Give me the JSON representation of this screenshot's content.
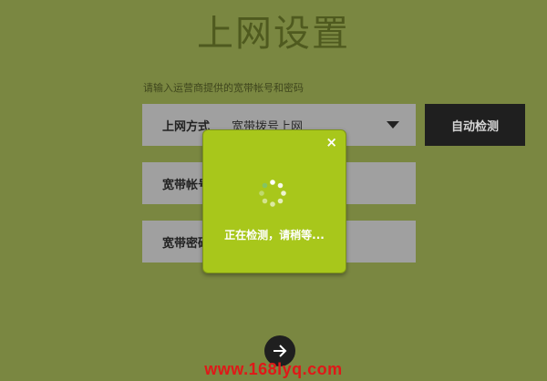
{
  "page": {
    "title": "上网设置",
    "hint": "请输入运营商提供的宽带帐号和密码"
  },
  "connection": {
    "label": "上网方式",
    "value": "宽带拨号上网"
  },
  "account": {
    "label": "宽带帐号"
  },
  "password": {
    "label": "宽带密码"
  },
  "detect_button": {
    "label": "自动检测"
  },
  "modal": {
    "close_glyph": "×",
    "message": "正在检测，请稍等..."
  },
  "watermark": "www.168lyq.com",
  "colors": {
    "background": "#7a8741",
    "modal": "#a8c71b",
    "button_dark": "#1f1f1f",
    "watermark": "#e01818"
  }
}
